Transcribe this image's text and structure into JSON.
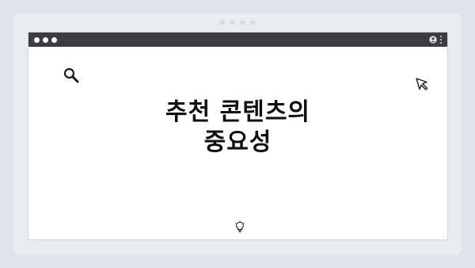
{
  "window": {
    "title_lines": [
      "추천 콘텐츠의",
      "중요성"
    ]
  },
  "icons": {
    "search": "search-icon",
    "cursor": "cursor-arrow-icon",
    "bulb": "lightbulb-icon",
    "avatar": "user-avatar-icon",
    "menu": "kebab-menu-icon"
  },
  "colors": {
    "background": "#dfe4ea",
    "titlebar": "#3b3d40",
    "window": "#ffffff",
    "text": "#111111"
  }
}
